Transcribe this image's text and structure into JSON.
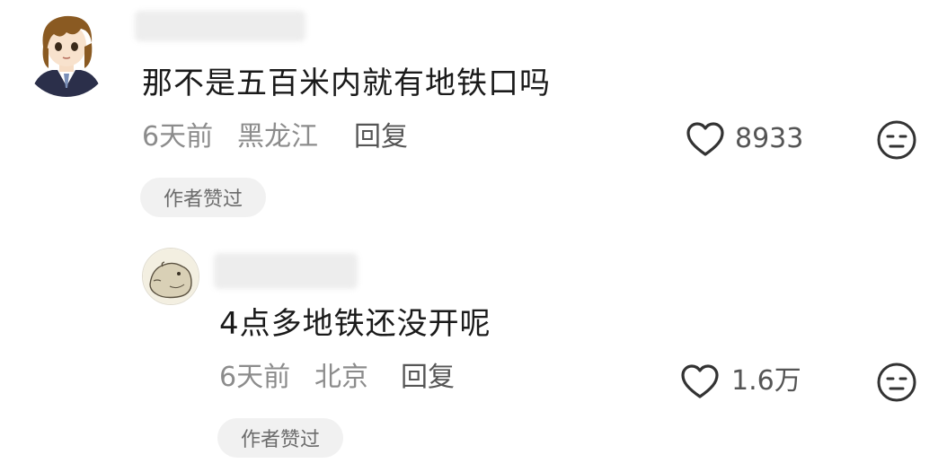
{
  "comments": [
    {
      "text": "那不是五百米内就有地铁口吗",
      "time": "6天前",
      "location": "黑龙江",
      "reply_label": "回复",
      "likes": "8933",
      "badge": "作者赞过",
      "avatar_icon": "anime-girl-avatar-icon"
    },
    {
      "text": "4点多地铁还没开呢",
      "time": "6天前",
      "location": "北京",
      "reply_label": "回复",
      "likes": "1.6万",
      "badge": "作者赞过",
      "avatar_icon": "capybara-avatar-icon"
    }
  ],
  "icons": {
    "like": "heart-outline-icon",
    "reaction": "neutral-face-icon"
  },
  "colors": {
    "text": "#1a1a1a",
    "meta": "#8c8c8c",
    "badge_bg": "#f1f1f1"
  }
}
